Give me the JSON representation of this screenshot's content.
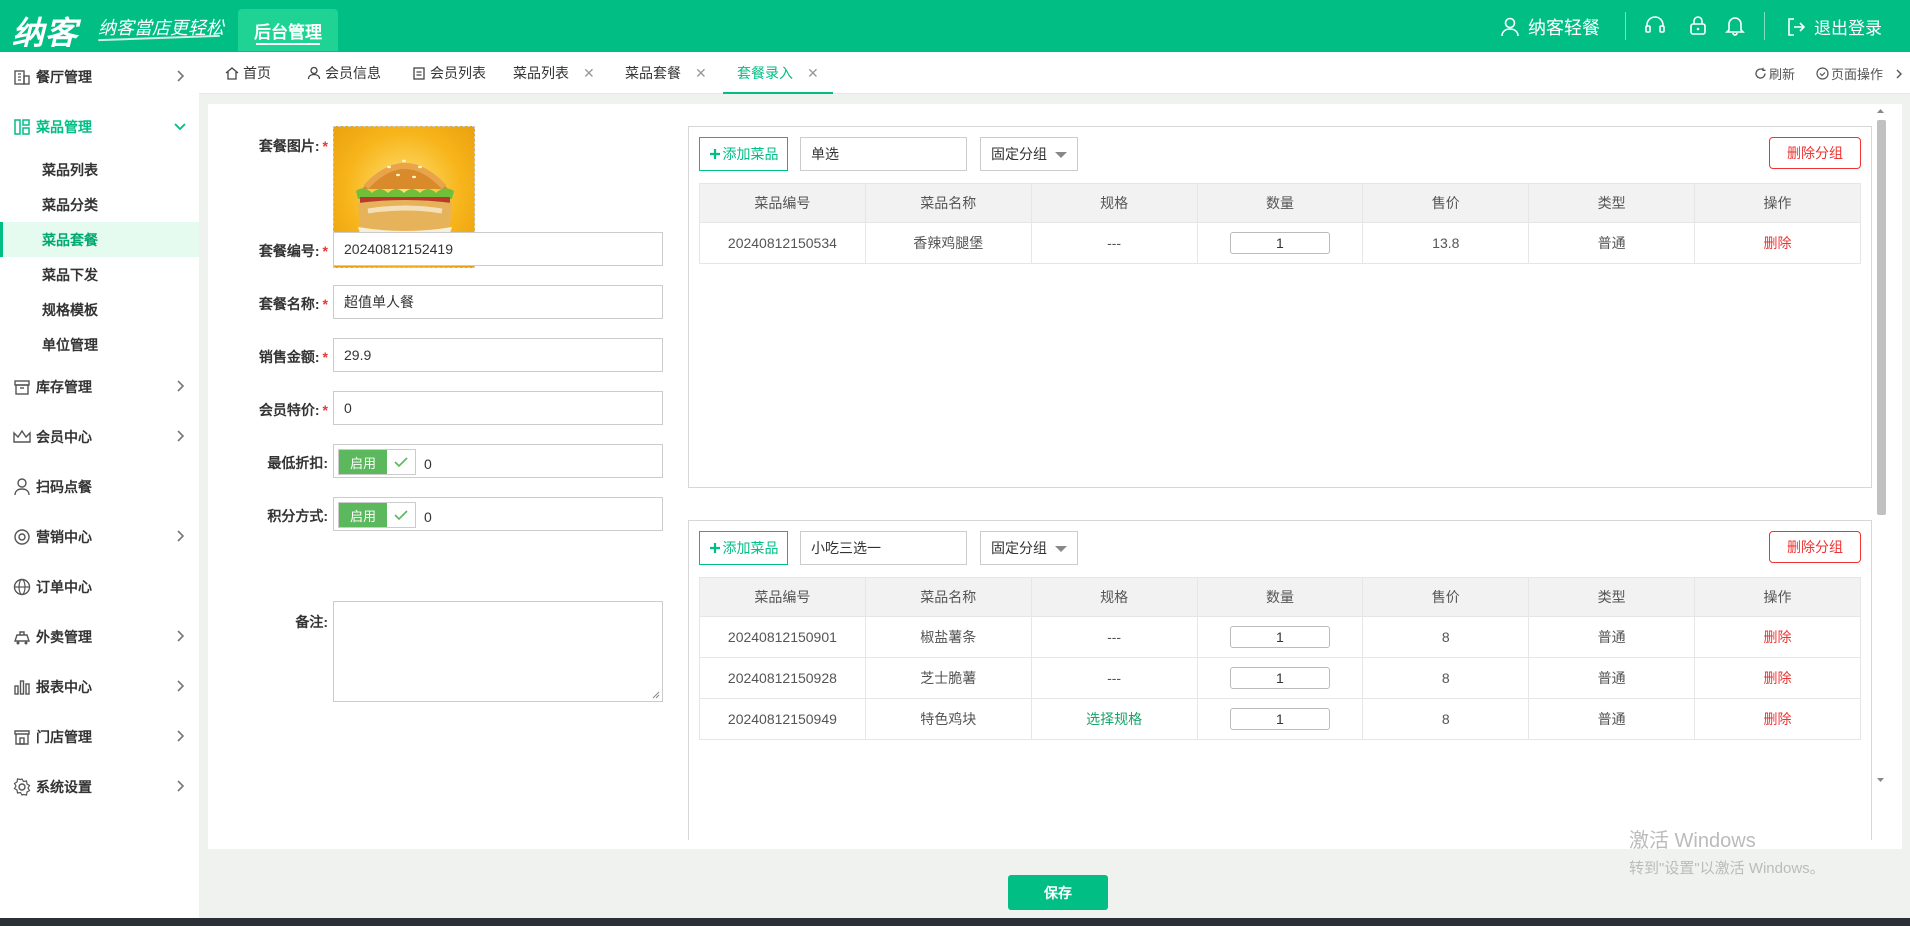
{
  "brand": {
    "logo": "纳客",
    "slogan": "纳客當店更轻松",
    "admin_tab": "后台管理"
  },
  "header": {
    "user": "纳客轻餐",
    "logout": "退出登录"
  },
  "sidebar": {
    "items": [
      {
        "label": "餐厅管理"
      },
      {
        "label": "菜品管理"
      },
      {
        "label": "库存管理"
      },
      {
        "label": "会员中心"
      },
      {
        "label": "扫码点餐"
      },
      {
        "label": "营销中心"
      },
      {
        "label": "订单中心"
      },
      {
        "label": "外卖管理"
      },
      {
        "label": "报表中心"
      },
      {
        "label": "门店管理"
      },
      {
        "label": "系统设置"
      }
    ],
    "sub_items": [
      "菜品列表",
      "菜品分类",
      "菜品套餐",
      "菜品下发",
      "规格模板",
      "单位管理"
    ]
  },
  "tabs": [
    {
      "label": "首页"
    },
    {
      "label": "会员信息"
    },
    {
      "label": "会员列表"
    },
    {
      "label": "菜品列表"
    },
    {
      "label": "菜品套餐"
    },
    {
      "label": "套餐录入"
    }
  ],
  "tab_actions": {
    "refresh": "刷新",
    "page_ops": "页面操作"
  },
  "form": {
    "image_label": "套餐图片:",
    "code_label": "套餐编号:",
    "code_value": "20240812152419",
    "name_label": "套餐名称:",
    "name_value": "超值单人餐",
    "price_label": "销售金额:",
    "price_value": "29.9",
    "member_label": "会员特价:",
    "member_value": "0",
    "discount_label": "最低折扣:",
    "discount_toggle": "启用",
    "discount_value": "0",
    "points_label": "积分方式:",
    "points_toggle": "启用",
    "points_value": "0",
    "note_label": "备注:"
  },
  "group_controls": {
    "add": "添加菜品",
    "select": "固定分组",
    "delete": "删除分组"
  },
  "table_headers": [
    "菜品编号",
    "菜品名称",
    "规格",
    "数量",
    "售价",
    "类型",
    "操作"
  ],
  "groups": [
    {
      "name": "单选",
      "rows": [
        {
          "code": "20240812150534",
          "name": "香辣鸡腿堡",
          "spec": "---",
          "qty": "1",
          "price": "13.8",
          "type": "普通",
          "op": "删除"
        }
      ]
    },
    {
      "name": "小吃三选一",
      "rows": [
        {
          "code": "20240812150901",
          "name": "椒盐薯条",
          "spec": "---",
          "qty": "1",
          "price": "8",
          "type": "普通",
          "op": "删除"
        },
        {
          "code": "20240812150928",
          "name": "芝士脆薯",
          "spec": "---",
          "qty": "1",
          "price": "8",
          "type": "普通",
          "op": "删除"
        },
        {
          "code": "20240812150949",
          "name": "特色鸡块",
          "spec": "选择规格",
          "qty": "1",
          "price": "8",
          "type": "普通",
          "op": "删除"
        }
      ]
    }
  ],
  "save_label": "保存",
  "watermark": {
    "line1": "激活 Windows",
    "line2": "转到\"设置\"以激活 Windows。"
  }
}
